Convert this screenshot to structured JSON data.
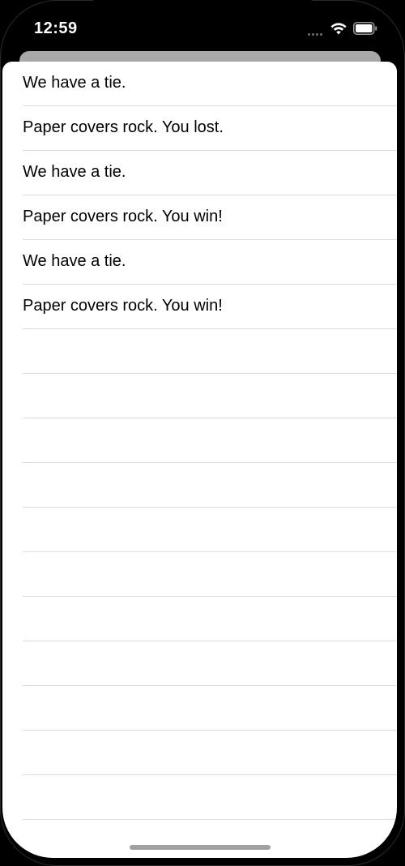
{
  "status_bar": {
    "time": "12:59",
    "icons": [
      "cellular-signal-icon",
      "wifi-icon",
      "battery-icon"
    ]
  },
  "results_list": {
    "rows": [
      "We have a tie.",
      "Paper covers rock. You lost.",
      "We have a tie.",
      "Paper covers rock. You win!",
      "We have a tie.",
      "Paper covers rock. You win!"
    ],
    "empty_rows": 11
  },
  "colors": {
    "background": "#000000",
    "sheet": "#ffffff",
    "separator": "#dcdcdc",
    "back_card": "#a8a8a8",
    "home_indicator": "#a0a0a0",
    "text": "#000000"
  }
}
